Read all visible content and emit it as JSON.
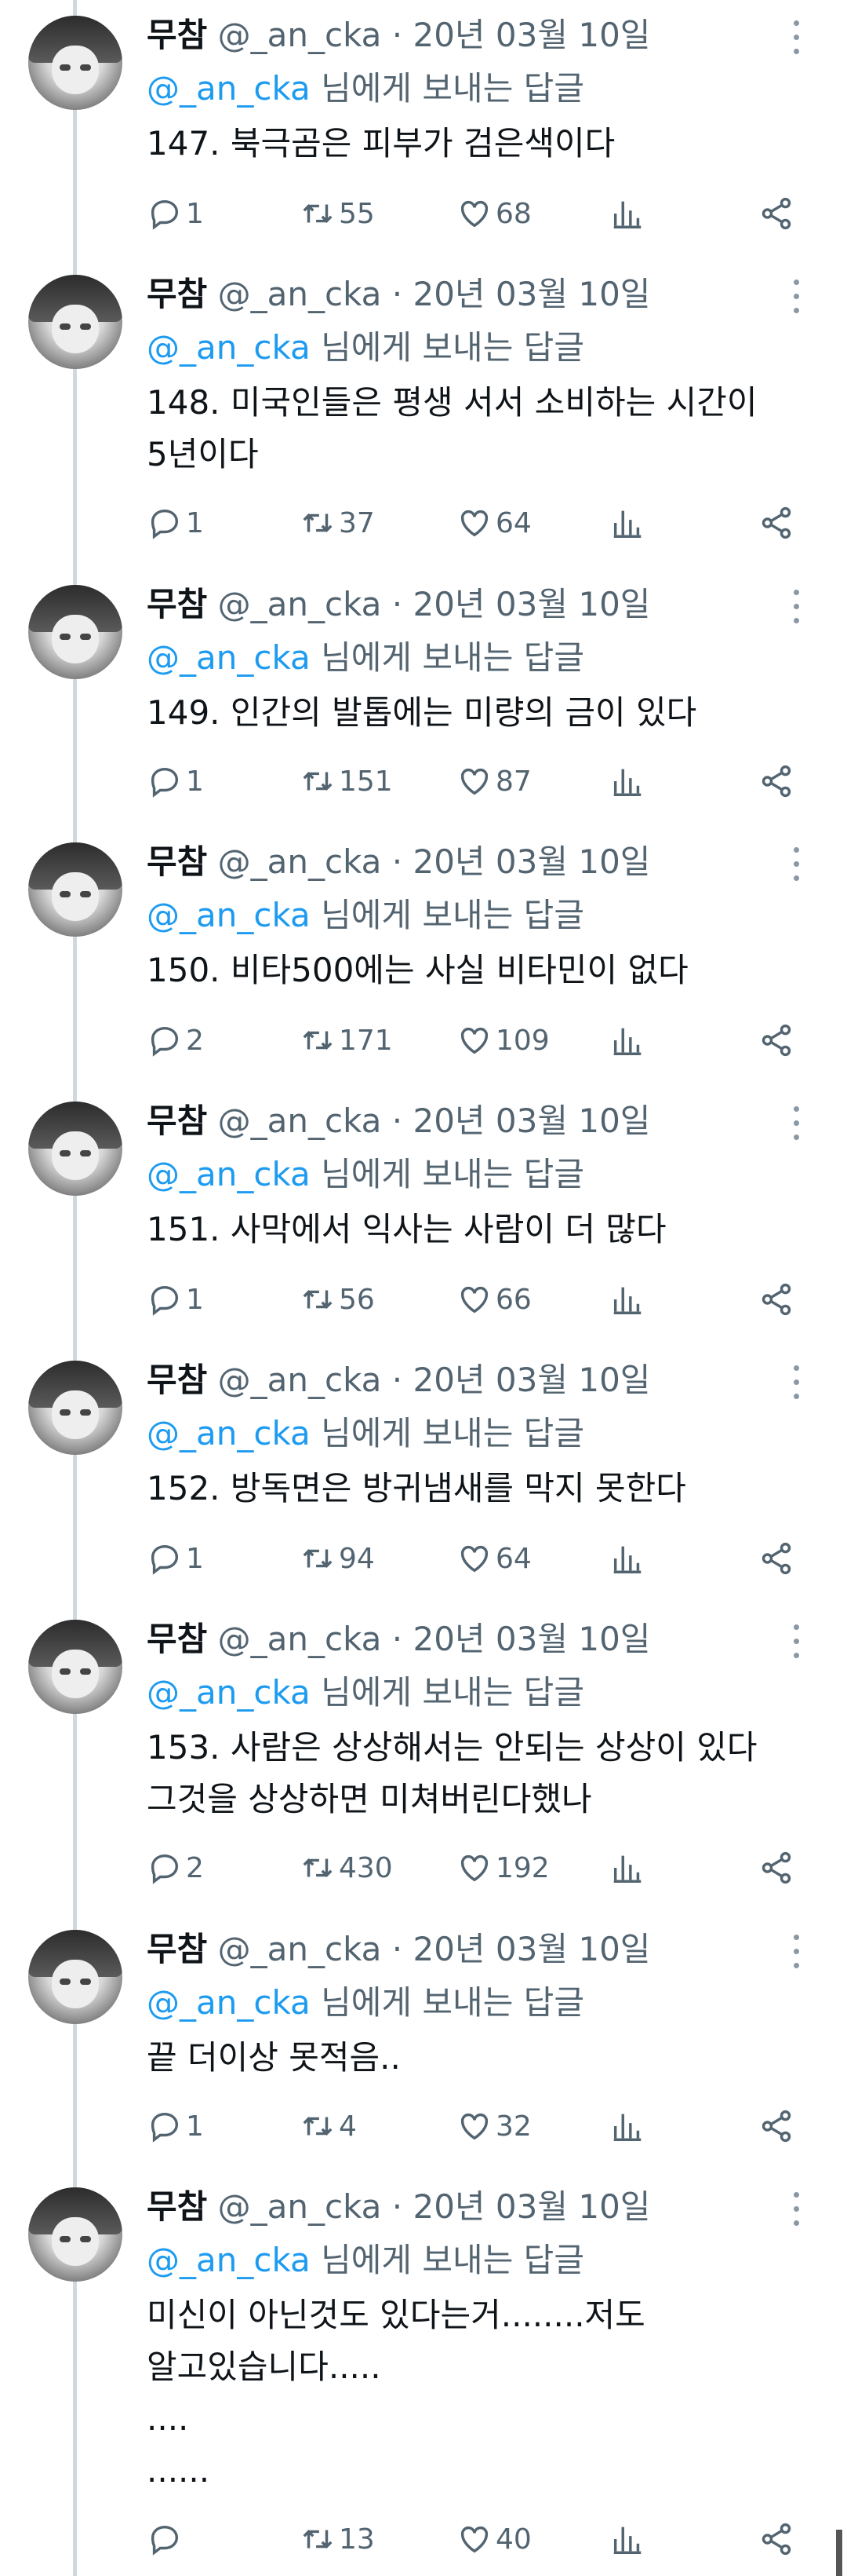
{
  "author": {
    "name": "무참",
    "handle": "@_an_cka",
    "date": "20년 03월 10일"
  },
  "reply_mention": "@_an_cka",
  "reply_suffix": "님에게 보내는 답글",
  "tweets": [
    {
      "text": "147. 북극곰은 피부가 검은색이다",
      "replies": "1",
      "retweets": "55",
      "likes": "68"
    },
    {
      "text": "148. 미국인들은 평생 서서 소비하는 시간이\n5년이다",
      "replies": "1",
      "retweets": "37",
      "likes": "64"
    },
    {
      "text": "149. 인간의 발톱에는 미량의 금이 있다",
      "replies": "1",
      "retweets": "151",
      "likes": "87"
    },
    {
      "text": "150. 비타500에는 사실 비타민이 없다",
      "replies": "2",
      "retweets": "171",
      "likes": "109"
    },
    {
      "text": "151. 사막에서 익사는 사람이 더 많다",
      "replies": "1",
      "retweets": "56",
      "likes": "66"
    },
    {
      "text": "152. 방독면은 방귀냄새를 막지 못한다",
      "replies": "1",
      "retweets": "94",
      "likes": "64"
    },
    {
      "text": "153. 사람은 상상해서는 안되는 상상이 있다\n그것을 상상하면 미쳐버린다했나",
      "replies": "2",
      "retweets": "430",
      "likes": "192"
    },
    {
      "text": "끝 더이상 못적음..",
      "replies": "1",
      "retweets": "4",
      "likes": "32"
    },
    {
      "text": "미신이 아닌것도 있다는거........저도\n알고있습니다.....\n....\n......",
      "replies": "",
      "retweets": "13",
      "likes": "40"
    }
  ]
}
